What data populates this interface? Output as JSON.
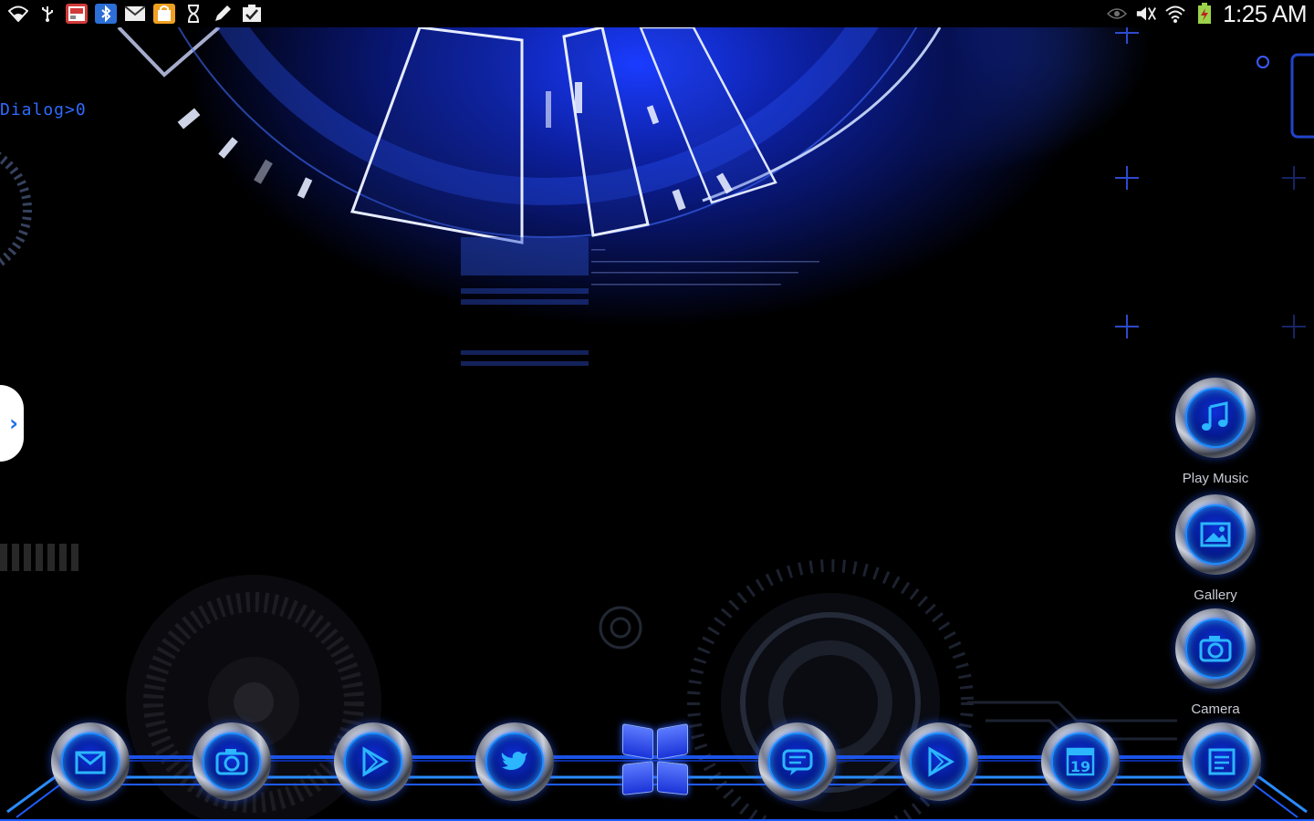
{
  "status_bar": {
    "left_icons": [
      "wifi-icon",
      "usb-icon",
      "app-notification-icon",
      "bluetooth-app-icon",
      "mail-icon",
      "shop-notification-icon",
      "hourglass-icon",
      "pen-icon",
      "task-check-icon"
    ],
    "right_icons": [
      "eye-icon",
      "mute-icon",
      "wifi-signal-icon",
      "battery-charging-icon"
    ],
    "time": "1:25 AM"
  },
  "wallpaper": {
    "dialog_text": "Dialog>0",
    "accent_color": "#1a3cff"
  },
  "shortcuts": [
    {
      "label": "Play Music",
      "icon": "music-note-icon"
    },
    {
      "label": "Gallery",
      "icon": "gallery-icon"
    },
    {
      "label": "Camera",
      "icon": "camera-icon"
    }
  ],
  "dock": {
    "items": [
      {
        "name": "email",
        "icon": "email-icon"
      },
      {
        "name": "camera",
        "icon": "camera-icon"
      },
      {
        "name": "play-store",
        "icon": "play-store-icon"
      },
      {
        "name": "twitter",
        "icon": "twitter-bird-icon"
      },
      {
        "name": "app-drawer",
        "icon": "app-drawer-grid-icon"
      },
      {
        "name": "messaging",
        "icon": "message-bubble-icon"
      },
      {
        "name": "play-store-2",
        "icon": "play-store-icon"
      },
      {
        "name": "calendar",
        "icon": "calendar-icon"
      },
      {
        "name": "memo",
        "icon": "memo-icon"
      }
    ],
    "calendar_number": "19",
    "neon_color": "#1e5bff"
  },
  "drawer_handle": {
    "glyph": "›"
  }
}
